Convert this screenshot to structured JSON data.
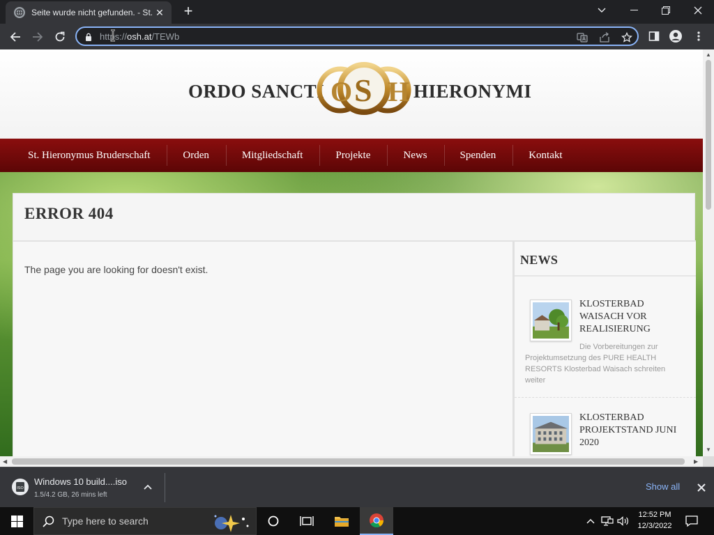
{
  "browser": {
    "tab_title": "Seite wurde nicht gefunden. - St.",
    "url_scheme": "https://",
    "url_host": "osh.at",
    "url_path": "/TEWb"
  },
  "site": {
    "logo_left": "ORDO SANCTI",
    "logo_right": "HIERONYMI",
    "emblem_letters": "OSH",
    "nav": [
      "St. Hieronymus Bruderschaft",
      "Orden",
      "Mitgliedschaft",
      "Projekte",
      "News",
      "Spenden",
      "Kontakt"
    ],
    "error_title": "ERROR 404",
    "message": "The page you are looking for doesn't exist.",
    "sidebar": {
      "title": "NEWS",
      "items": [
        {
          "headline": "KLOSTERBAD WAISACH VOR REALISIERUNG",
          "excerpt": "Die Vorbereitungen zur Projektumsetzung des PURE HEALTH RESORTS Klosterbad Waisach schreiten weiter"
        },
        {
          "headline": "KLOSTERBAD PROJEKTSTAND JUNI 2020",
          "excerpt": ""
        }
      ]
    }
  },
  "download": {
    "file_name": "Windows 10 build....iso",
    "status": "1.5/4.2 GB, 26 mins left",
    "show_all": "Show all"
  },
  "taskbar": {
    "search_placeholder": "Type here to search",
    "time": "12:52 PM",
    "date": "12/3/2022"
  },
  "colors": {
    "nav_red": "#7a0b0b",
    "accent_blue": "#8ab4f8",
    "chrome_dark": "#202124"
  }
}
